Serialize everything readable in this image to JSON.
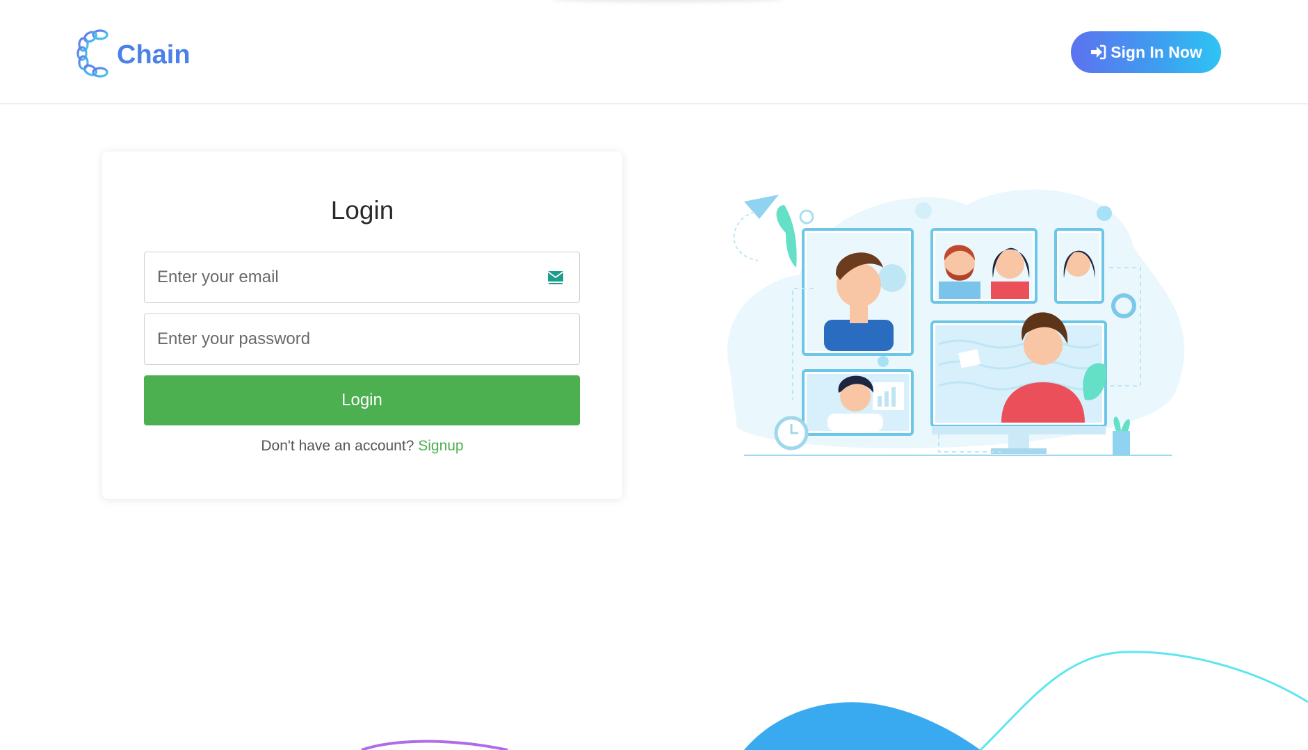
{
  "header": {
    "logo_text": "Chain",
    "signin_label": "Sign In Now",
    "signin_icon": "sign-in-icon"
  },
  "login_card": {
    "title": "Login",
    "email_placeholder": "Enter your email",
    "email_icon": "mail-icon",
    "password_placeholder": "Enter your password",
    "login_button_label": "Login",
    "signup_prompt": "Don't have an account?",
    "signup_link_label": "Signup"
  },
  "colors": {
    "brand_blue": "#4a80e8",
    "signin_gradient_start": "#5d72ef",
    "signin_gradient_end": "#2ec4f3",
    "login_green": "#4caf50",
    "wave_blue": "#3aaaf0",
    "wave_cyan": "#5ee6f0",
    "wave_purple": "#b06be8"
  }
}
